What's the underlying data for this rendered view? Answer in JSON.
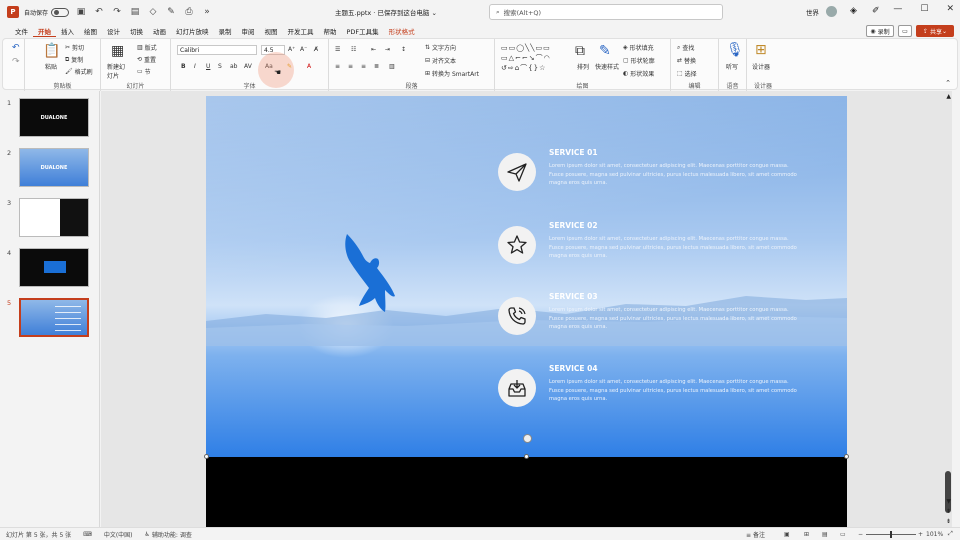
{
  "titlebar": {
    "autosave_label": "自动保存",
    "doc_title": "主题五.pptx · 已保存到这台电脑 ⌄",
    "search_placeholder": "搜索(Alt+Q)",
    "user_name": "世界"
  },
  "menu": {
    "items": [
      "文件",
      "开始",
      "插入",
      "绘图",
      "设计",
      "切换",
      "动画",
      "幻灯片放映",
      "录制",
      "审阅",
      "视图",
      "开发工具",
      "帮助",
      "PDF工具集",
      "形状格式"
    ],
    "active_index": 1,
    "record_button": "录制",
    "share_button": "共享"
  },
  "ribbon": {
    "clipboard": {
      "label": "剪贴板",
      "paste": "粘贴",
      "cut": "剪切",
      "copy": "复制",
      "format_painter": "格式刷"
    },
    "slides": {
      "label": "幻灯片",
      "new_slide": "新建幻灯片",
      "layout": "版式",
      "reset": "重置",
      "section": "节"
    },
    "font": {
      "label": "字体",
      "font_name": "Calibri",
      "font_size": "4.5"
    },
    "paragraph": {
      "label": "段落",
      "text_direction": "文字方向",
      "align_text": "对齐文本",
      "smartart": "转换为 SmartArt"
    },
    "drawing": {
      "label": "绘图",
      "arrange": "排列",
      "quick_styles": "快速样式",
      "shape_fill": "形状填充",
      "shape_outline": "形状轮廓",
      "shape_effects": "形状效果"
    },
    "editing": {
      "label": "编辑",
      "find": "查找",
      "replace": "替换",
      "select": "选择"
    },
    "voice": {
      "label": "语音",
      "dictate": "听写"
    },
    "designer": {
      "label": "设计器",
      "designer_btn": "设计器"
    }
  },
  "slides_panel": [
    {
      "num": "1",
      "text": "DUALONE"
    },
    {
      "num": "2",
      "text": "DUALONE"
    },
    {
      "num": "3",
      "text": ""
    },
    {
      "num": "4",
      "text": ""
    },
    {
      "num": "5",
      "text": ""
    }
  ],
  "slide": {
    "services": [
      {
        "title": "SERVICE 01",
        "icon": "paper-plane-icon",
        "body": "Lorem ipsum dolor sit amet, consectetuer adipiscing elit. Maecenas porttitor congue massa. Fusce posuere, magna sed pulvinar ultricies, purus lectus malesuada libero, sit amet commodo magna eros quis urna."
      },
      {
        "title": "SERVICE 02",
        "icon": "star-icon",
        "body": "Lorem ipsum dolor sit amet, consectetuer adipiscing elit. Maecenas porttitor congue massa. Fusce posuere, magna sed pulvinar ultricies, purus lectus malesuada libero, sit amet commodo magna eros quis urna."
      },
      {
        "title": "SERVICE 03",
        "icon": "phone-icon",
        "body": "Lorem ipsum dolor sit amet, consectetuer adipiscing elit. Maecenas porttitor congue massa. Fusce posuere, magna sed pulvinar ultricies, purus lectus malesuada libero, sit amet commodo magna eros quis urna."
      },
      {
        "title": "SERVICE 04",
        "icon": "inbox-icon",
        "body": "Lorem ipsum dolor sit amet, consectetuer adipiscing elit. Maecenas porttitor congue massa. Fusce posuere, magna sed pulvinar ultricies, purus lectus malesuada libero, sit amet commodo magna eros quis urna."
      }
    ]
  },
  "status": {
    "slide_info": "幻灯片 第 5 张，共 5 张",
    "accessibility": "辅助功能: 调查",
    "language": "中文(中国)",
    "notes": "备注",
    "zoom": "101%"
  },
  "colors": {
    "accent": "#c43e1c",
    "bird": "#1a6fd6"
  }
}
